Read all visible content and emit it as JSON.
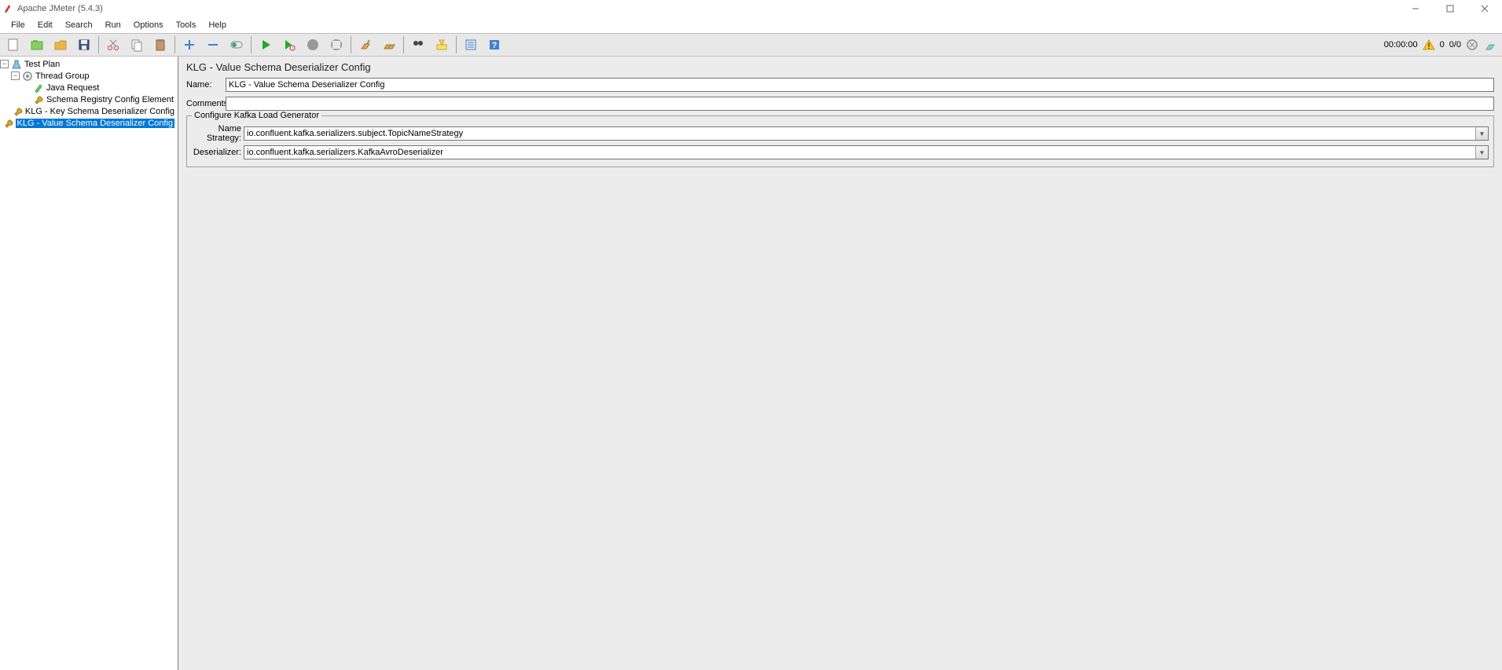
{
  "window": {
    "title": "Apache JMeter (5.4.3)"
  },
  "menu": {
    "items": [
      "File",
      "Edit",
      "Search",
      "Run",
      "Options",
      "Tools",
      "Help"
    ]
  },
  "toolbar": {
    "buttons": [
      "new",
      "templates",
      "open",
      "save",
      "cut",
      "copy",
      "paste",
      "add",
      "remove",
      "toggle",
      "start",
      "start-no-timers",
      "stop",
      "shutdown",
      "clear",
      "clear-all",
      "search-tree",
      "function-helper",
      "help-panel",
      "thread-dump",
      "gc"
    ],
    "status_time": "00:00:00",
    "warn_count": "0",
    "threads": "0/0"
  },
  "tree": {
    "root": {
      "label": "Test Plan"
    },
    "thread_group": {
      "label": "Thread Group"
    },
    "children": [
      {
        "label": "Java Request",
        "icon": "pencil"
      },
      {
        "label": "Schema Registry Config Element",
        "icon": "wrench"
      },
      {
        "label": "KLG - Key Schema Deserializer Config",
        "icon": "wrench"
      },
      {
        "label": "KLG - Value Schema Deserializer Config",
        "icon": "wrench",
        "selected": true
      }
    ]
  },
  "editor": {
    "title": "KLG - Value Schema Deserializer Config",
    "name_label": "Name:",
    "name_value": "KLG - Value Schema Deserializer Config",
    "comments_label": "Comments:",
    "comments_value": "",
    "fieldset_legend": "Configure Kafka Load Generator",
    "name_strategy_label": "Name Strategy:",
    "name_strategy_value": "io.confluent.kafka.serializers.subject.TopicNameStrategy",
    "deserializer_label": "Deserializer:",
    "deserializer_value": "io.confluent.kafka.serializers.KafkaAvroDeserializer"
  }
}
